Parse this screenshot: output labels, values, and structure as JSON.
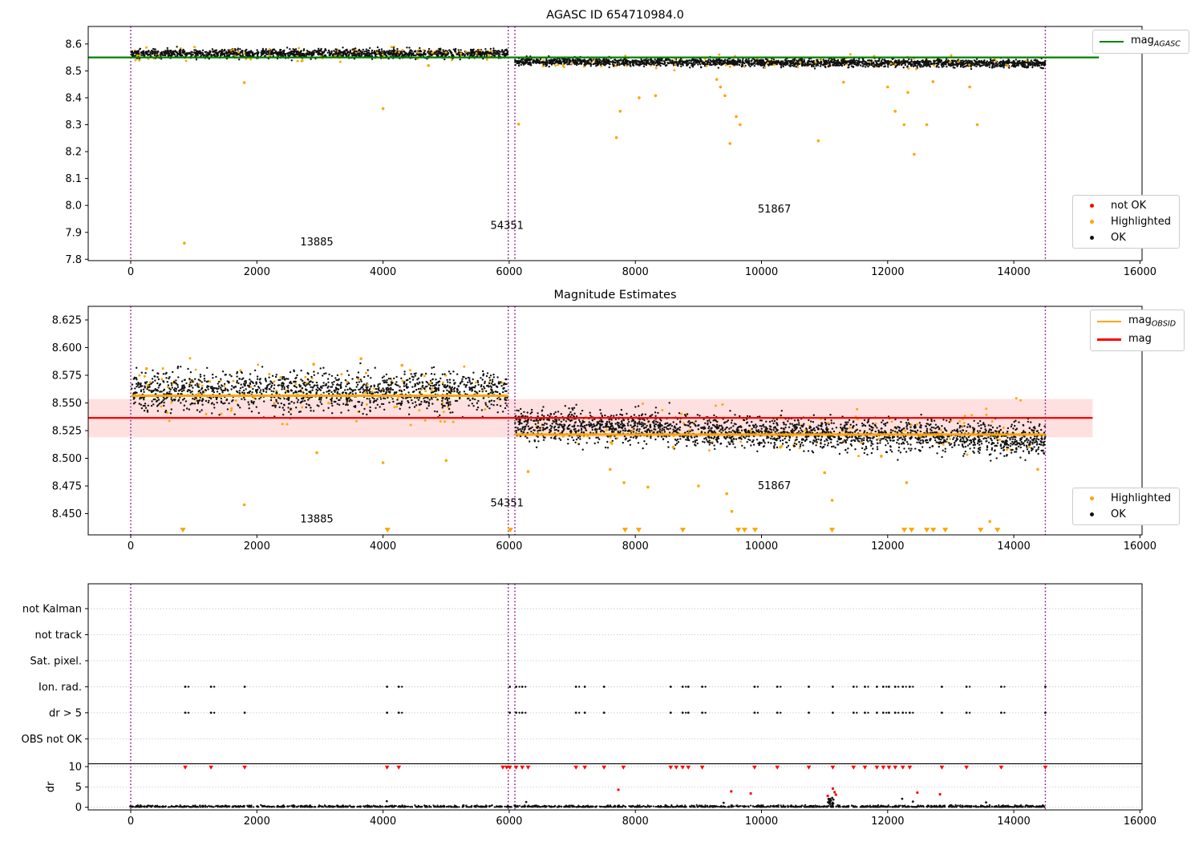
{
  "colors": {
    "green": "#008000",
    "orange": "#ffa500",
    "red": "#ff0000",
    "black": "#111111",
    "purple": "#800080",
    "grid": "#b5b5b5",
    "pink": "rgba(255,0,0,0.12)"
  },
  "legends": {
    "mag_agasc": {
      "items": [
        {
          "type": "line",
          "color": "#008000",
          "label": "mag",
          "sub": "AGASC"
        }
      ]
    },
    "top_markers": {
      "items": [
        {
          "type": "dot",
          "color": "#ff0000",
          "label": "not OK"
        },
        {
          "type": "dot",
          "color": "#ffa500",
          "label": "Highlighted"
        },
        {
          "type": "dot",
          "color": "#111111",
          "label": "OK"
        }
      ]
    },
    "mid_lines": {
      "items": [
        {
          "type": "line",
          "color": "#ffa500",
          "label": "mag",
          "sub": "OBSID"
        },
        {
          "type": "line",
          "color": "#ff0000",
          "label": "mag",
          "sub": ""
        }
      ]
    },
    "mid_markers": {
      "items": [
        {
          "type": "dot",
          "color": "#ffa500",
          "label": "Highlighted"
        },
        {
          "type": "dot",
          "color": "#111111",
          "label": "OK"
        }
      ]
    }
  },
  "chart_data": [
    {
      "type": "scatter",
      "name": "agasc-mag-chart",
      "title": "AGASC ID 654710984.0",
      "xlim": [
        -674,
        16033
      ],
      "ylim": [
        7.795,
        8.665
      ],
      "xticks": [
        0,
        2000,
        4000,
        6000,
        8000,
        10000,
        12000,
        14000,
        16000
      ],
      "yticks": [
        7.8,
        7.9,
        8.0,
        8.1,
        8.2,
        8.3,
        8.4,
        8.5,
        8.6
      ],
      "ydec": 1,
      "vlines": [
        0,
        5985,
        6090,
        14500
      ],
      "hlines": [
        {
          "y": 8.55,
          "x0": -674,
          "x1": 15350,
          "color": "green",
          "w": 2.2,
          "name": "mag-agasc-line"
        }
      ],
      "bands": [
        {
          "color": "orange",
          "x0": 10,
          "x1": 5975,
          "n": 80,
          "center": 8.562,
          "sd": 0.013,
          "r": 1.5
        },
        {
          "color": "black",
          "x0": 10,
          "x1": 5975,
          "n": 1350,
          "center": 8.5645,
          "sd": 0.0085,
          "r": 1.2
        },
        {
          "color": "orange",
          "x0": 10,
          "x1": 5975,
          "n": 28,
          "center": 8.558,
          "sd": 0.012,
          "r": 1.4
        },
        {
          "color": "orange",
          "x0": 6090,
          "x1": 14500,
          "n": 70,
          "center": 8.53,
          "sd": 0.013,
          "r": 1.5
        },
        {
          "color": "black",
          "x0": 6090,
          "x1": 14500,
          "n": 2150,
          "center": 8.5345,
          "center2": 8.5265,
          "sd": 0.0075,
          "r": 1.2
        },
        {
          "color": "orange",
          "x0": 6090,
          "x1": 14500,
          "n": 28,
          "center": 8.529,
          "sd": 0.011,
          "r": 1.4
        }
      ],
      "points": [
        {
          "color": "orange",
          "r": 1.8,
          "xy": [
            [
              850,
              7.86
            ],
            [
              1800,
              8.456
            ],
            [
              4000,
              8.36
            ],
            [
              4720,
              8.52
            ],
            [
              6150,
              8.302
            ],
            [
              7700,
              8.252
            ],
            [
              7760,
              8.35
            ],
            [
              8060,
              8.4
            ],
            [
              8320,
              8.408
            ],
            [
              9290,
              8.468
            ],
            [
              9350,
              8.44
            ],
            [
              9420,
              8.408
            ],
            [
              9500,
              8.23
            ],
            [
              9600,
              8.33
            ],
            [
              9660,
              8.3
            ],
            [
              10900,
              8.24
            ],
            [
              11300,
              8.458
            ],
            [
              12000,
              8.44
            ],
            [
              12120,
              8.35
            ],
            [
              12260,
              8.3
            ],
            [
              12320,
              8.42
            ],
            [
              12420,
              8.19
            ],
            [
              12620,
              8.3
            ],
            [
              12720,
              8.46
            ],
            [
              13300,
              8.44
            ],
            [
              13420,
              8.3
            ],
            [
              13900,
              8.52
            ]
          ]
        }
      ],
      "annotations": [
        {
          "text": "13885",
          "x": 2950,
          "y": 7.851
        },
        {
          "text": "54351",
          "x": 5966,
          "y": 7.912
        },
        {
          "text": "51867",
          "x": 10204,
          "y": 7.974
        }
      ]
    },
    {
      "type": "scatter",
      "name": "mag-estimates-chart",
      "title": "Magnitude Estimates",
      "xlim": [
        -674,
        16033
      ],
      "ylim": [
        8.4308,
        8.6373
      ],
      "xticks": [
        0,
        2000,
        4000,
        6000,
        8000,
        10000,
        12000,
        14000,
        16000
      ],
      "yticks": [
        8.45,
        8.475,
        8.5,
        8.525,
        8.55,
        8.575,
        8.6,
        8.625
      ],
      "ydec": 3,
      "vlines": [
        0,
        5985,
        6090,
        14500
      ],
      "band_fill": {
        "x0": -674,
        "x1": 15250,
        "y0": 8.519,
        "y1": 8.5535
      },
      "hlines": [
        {
          "y": 8.5365,
          "x0": -674,
          "x1": 15250,
          "color": "red",
          "w": 2.2,
          "name": "mag-line"
        }
      ],
      "steps": [
        {
          "x0": 10,
          "x1": 5985,
          "y": 8.5565,
          "color": "orange",
          "w": 3
        },
        {
          "x0": 6090,
          "x1": 14500,
          "y": 8.5215,
          "color": "orange",
          "w": 3
        }
      ],
      "bands": [
        {
          "color": "orange",
          "x0": 10,
          "x1": 5975,
          "n": 95,
          "center": 8.558,
          "sd": 0.013,
          "r": 1.5
        },
        {
          "color": "black",
          "x0": 10,
          "x1": 5975,
          "n": 1450,
          "center": 8.5605,
          "sd": 0.009,
          "r": 1.2
        },
        {
          "color": "orange",
          "x0": 10,
          "x1": 5975,
          "n": 22,
          "center": 8.562,
          "sd": 0.012,
          "r": 1.4
        },
        {
          "color": "orange",
          "x0": 6090,
          "x1": 14500,
          "n": 85,
          "center": 8.527,
          "sd": 0.012,
          "r": 1.5
        },
        {
          "color": "black",
          "x0": 6090,
          "x1": 14500,
          "n": 2250,
          "center": 8.5305,
          "center2": 8.5165,
          "sd": 0.0075,
          "r": 1.2
        },
        {
          "color": "orange",
          "x0": 6090,
          "x1": 14500,
          "n": 22,
          "center": 8.524,
          "sd": 0.01,
          "r": 1.4
        }
      ],
      "points": [
        {
          "color": "orange",
          "r": 1.8,
          "xy": [
            [
              250,
              8.581
            ],
            [
              2900,
              8.585
            ],
            [
              3650,
              8.59
            ],
            [
              4300,
              8.584
            ],
            [
              1800,
              8.458
            ],
            [
              2950,
              8.505
            ],
            [
              4000,
              8.496
            ],
            [
              5000,
              8.498
            ],
            [
              6300,
              8.488
            ],
            [
              7600,
              8.49
            ],
            [
              7820,
              8.478
            ],
            [
              8200,
              8.474
            ],
            [
              8600,
              8.51
            ],
            [
              9000,
              8.475
            ],
            [
              9450,
              8.468
            ],
            [
              9530,
              8.452
            ],
            [
              10300,
              8.51
            ],
            [
              11000,
              8.487
            ],
            [
              11120,
              8.462
            ],
            [
              11900,
              8.502
            ],
            [
              12300,
              8.478
            ],
            [
              12520,
              8.52
            ],
            [
              13620,
              8.443
            ],
            [
              14380,
              8.49
            ]
          ]
        }
      ],
      "clipped": {
        "color": "orange",
        "y": 8.4352,
        "x": [
          827,
          4071,
          6018,
          7837,
          8053,
          8753,
          9631,
          9732,
          9898,
          11119,
          12264,
          12379,
          12621,
          12723,
          12913,
          13473,
          13740
        ]
      },
      "annotations": [
        {
          "text": "13885",
          "x": 2950,
          "y": 8.442
        },
        {
          "text": "54351",
          "x": 5966,
          "y": 8.4565
        },
        {
          "text": "51867",
          "x": 10204,
          "y": 8.472
        }
      ]
    },
    {
      "type": "flags",
      "name": "quality-flags-chart",
      "rows": [
        "not Kalman",
        "not track",
        "Sat. pixel.",
        "Ion. rad.",
        "dr > 5",
        "OBS not OK"
      ],
      "ylabel": "dr",
      "dr_ticks": [
        10,
        5,
        0
      ],
      "xlim": [
        -674,
        16033
      ],
      "xticks": [
        0,
        2000,
        4000,
        6000,
        8000,
        10000,
        12000,
        14000,
        16000
      ],
      "vlines": [
        0,
        5985,
        6090,
        14500
      ],
      "threshold_dr": 10.7,
      "flags": [
        {
          "row": "Ion. rad.",
          "x": [
            865,
            1272,
            1806,
            4064,
            4249,
            6010,
            6110,
            6207,
            7059,
            7199,
            7504,
            8560,
            8750,
            8840,
            9060,
            9890,
            10250,
            10750,
            11130,
            11460,
            11640,
            11830,
            11930,
            12020,
            12120,
            12240,
            12350,
            12860,
            13250,
            13800,
            14500
          ]
        },
        {
          "row": "dr > 5",
          "x": [
            865,
            1272,
            1806,
            4064,
            4249,
            6010,
            6110,
            6207,
            7059,
            7199,
            7504,
            8560,
            8750,
            8840,
            9060,
            9890,
            10250,
            10750,
            11130,
            11460,
            11640,
            11830,
            11930,
            12020,
            12120,
            12240,
            12350,
            12860,
            13250,
            13800,
            14500
          ]
        }
      ],
      "clipped_red_x": [
        865,
        1272,
        1806,
        4064,
        4249,
        5900,
        5960,
        6010,
        6110,
        6207,
        6300,
        7059,
        7199,
        7504,
        7810,
        8560,
        8650,
        8750,
        8840,
        9060,
        9890,
        10250,
        10750,
        11130,
        11460,
        11640,
        11830,
        11930,
        12020,
        12120,
        12240,
        12350,
        12860,
        13250,
        13800,
        14500
      ],
      "red_points": [
        [
          7730,
          4.3
        ],
        [
          9520,
          3.9
        ],
        [
          9830,
          3.4
        ],
        [
          11050,
          2.8
        ],
        [
          11130,
          4.6
        ],
        [
          11160,
          3.7
        ],
        [
          11180,
          3.1
        ],
        [
          12470,
          3.6
        ],
        [
          12830,
          3.2
        ]
      ],
      "black_points": [
        [
          4060,
          1.5
        ],
        [
          6270,
          1.3
        ],
        [
          9400,
          1.1
        ],
        [
          11120,
          2.3
        ],
        [
          11140,
          1.9
        ],
        [
          12230,
          2.1
        ],
        [
          12400,
          1.4
        ],
        [
          13560,
          1.2
        ]
      ],
      "noise": {
        "x0": -10,
        "x1": 14500,
        "n": 1700,
        "base": 0.05,
        "max": 0.55
      },
      "noise_spike": {
        "x": 11100,
        "spread": 55,
        "n": 30,
        "max": 2.1
      }
    }
  ]
}
